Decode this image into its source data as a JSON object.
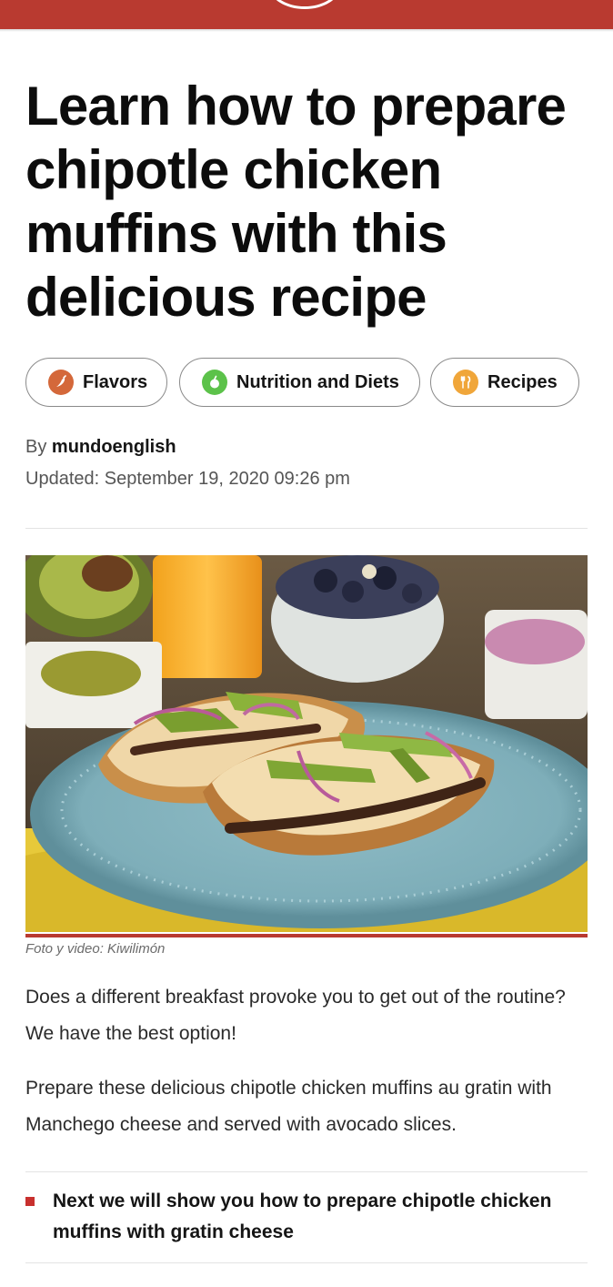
{
  "article": {
    "title": "Learn how to prepare chipotle chicken muffins with this delicious recipe",
    "tags": [
      {
        "label": "Flavors",
        "icon": "chili-pepper-icon",
        "color": "#d4683a"
      },
      {
        "label": "Nutrition and Diets",
        "icon": "apple-icon",
        "color": "#5cc24a"
      },
      {
        "label": "Recipes",
        "icon": "fork-knife-icon",
        "color": "#f0a63a"
      }
    ],
    "byline_prefix": "By",
    "author": "mundoenglish",
    "updated": "Updated: September 19, 2020 09:26 pm",
    "image_caption": "Foto y video: Kiwilimón",
    "paragraphs": [
      "Does a different breakfast provoke you to get out of the routine? We have the best option!",
      "Prepare these delicious chipotle chicken muffins au gratin with Manchego cheese and served with avocado slices."
    ],
    "list_items": [
      "Next we will show you how to prepare chipotle chicken muffins with gratin cheese"
    ]
  },
  "colors": {
    "brand": "#b93a30",
    "bullet": "#c8302e"
  }
}
